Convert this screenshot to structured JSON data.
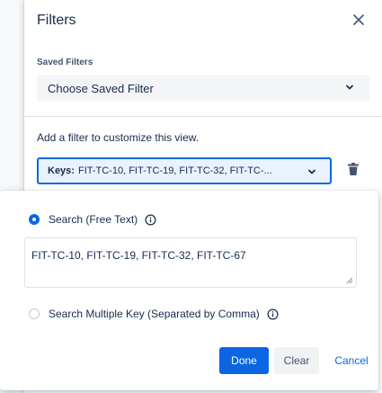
{
  "panel": {
    "title": "Filters",
    "close_icon": "close-icon"
  },
  "saved_filters": {
    "label": "Saved Filters",
    "selected": "Choose Saved Filter"
  },
  "hint": "Add a filter to customize this view.",
  "keys_filter": {
    "label": "Keys:",
    "value": "FIT-TC-10, FIT-TC-19, FIT-TC-32, FIT-TC-..."
  },
  "popover": {
    "option_free_text": {
      "label": "Search (Free Text)",
      "checked": true
    },
    "textarea_value": "FIT-TC-10, FIT-TC-19, FIT-TC-32, FIT-TC-67",
    "option_multi_key": {
      "label": "Search Multiple Key (Separated by Comma)",
      "checked": false
    },
    "buttons": {
      "done": "Done",
      "clear": "Clear",
      "cancel": "Cancel"
    }
  },
  "colors": {
    "accent": "#0c66e4",
    "text": "#172b4d",
    "subtle": "#44546f"
  }
}
